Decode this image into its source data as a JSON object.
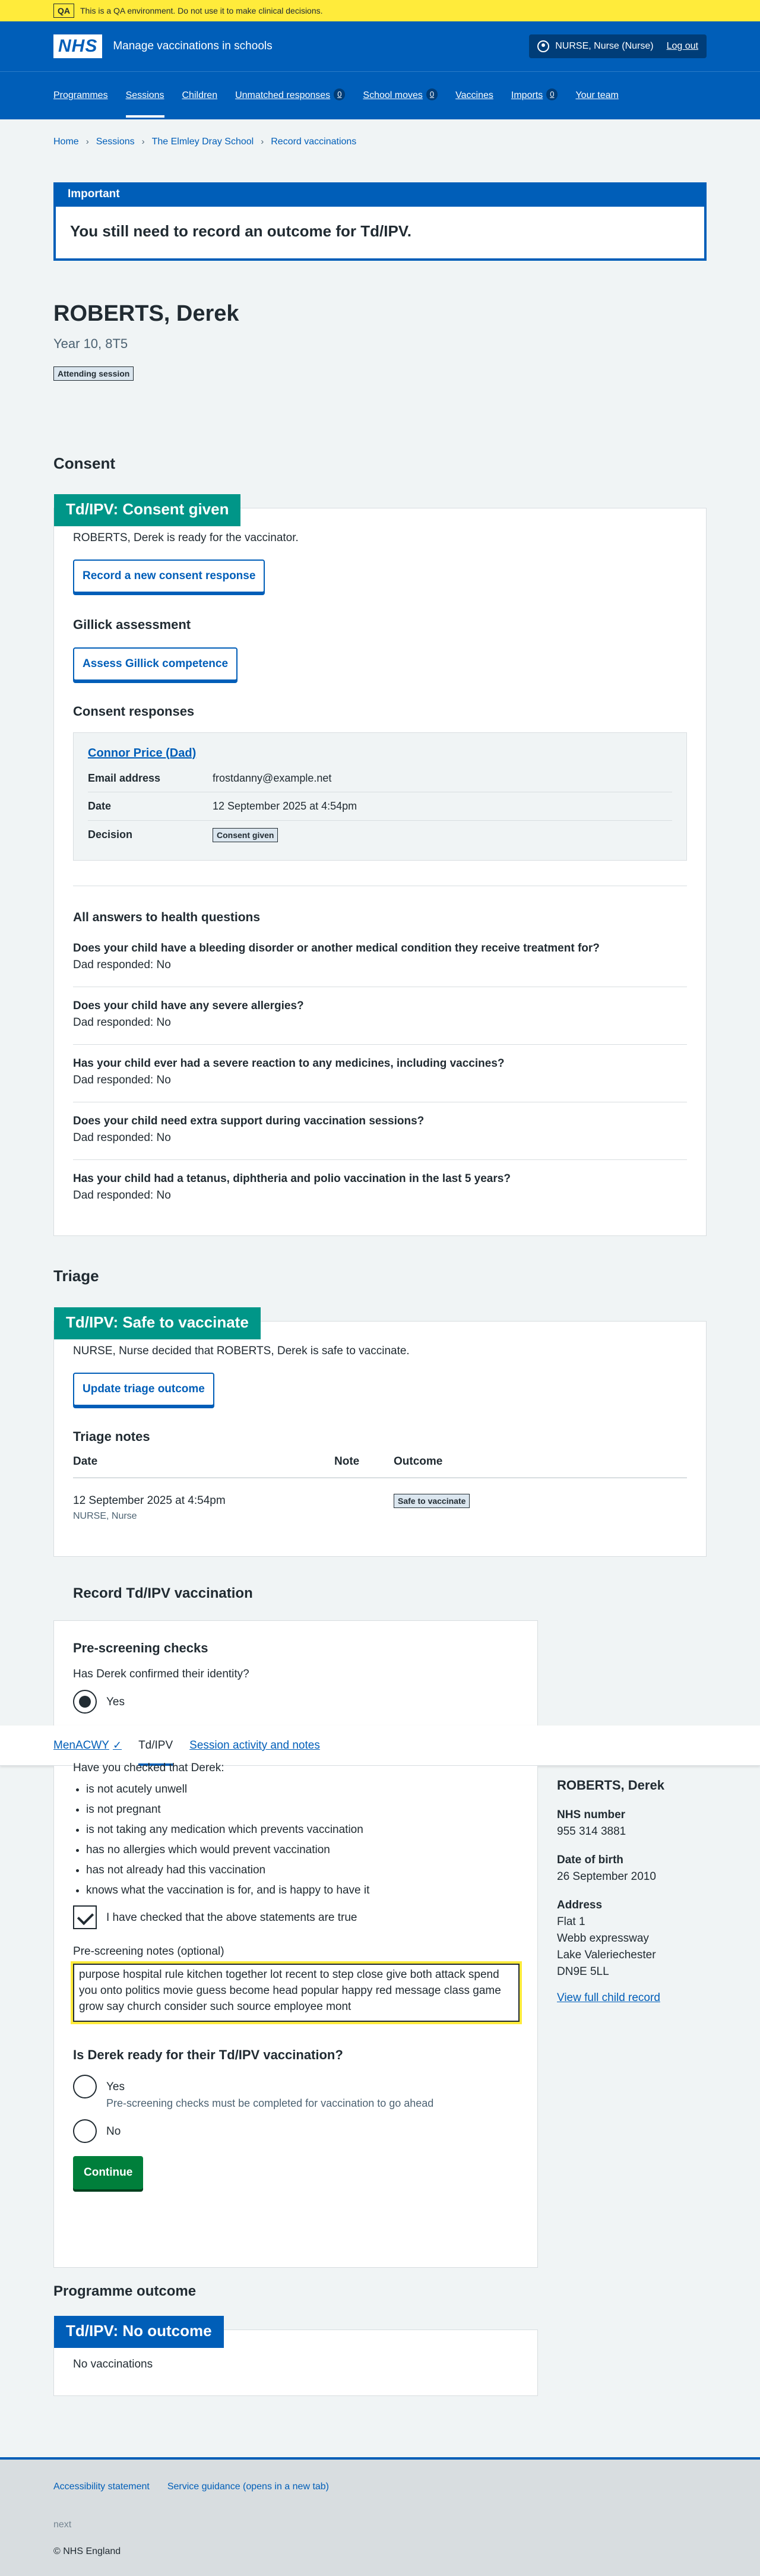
{
  "qa_banner": {
    "tag": "QA",
    "text": "This is a QA environment. Do not use it to make clinical decisions."
  },
  "header": {
    "logo": "NHS",
    "service_name": "Manage vaccinations in schools",
    "user": "NURSE, Nurse (Nurse)",
    "logout": "Log out",
    "nav": [
      {
        "label": "Programmes"
      },
      {
        "label": "Sessions"
      },
      {
        "label": "Children"
      },
      {
        "label": "Unmatched responses",
        "count": "0"
      },
      {
        "label": "School moves",
        "count": "0"
      },
      {
        "label": "Vaccines"
      },
      {
        "label": "Imports",
        "count": "0"
      },
      {
        "label": "Your team"
      }
    ]
  },
  "breadcrumb": [
    "Home",
    "Sessions",
    "The Elmley Dray School",
    "Record vaccinations"
  ],
  "important": {
    "heading": "Important",
    "message": "You still need to record an outcome for Td/IPV."
  },
  "patient": {
    "name": "ROBERTS, Derek",
    "year": "Year 10, 8T5",
    "status_tag": "Attending session"
  },
  "consent": {
    "section_title": "Consent",
    "card_title": "Td/IPV: Consent given",
    "ready_text": "ROBERTS, Derek is ready for the vaccinator.",
    "record_button": "Record a new consent response",
    "gillick_title": "Gillick assessment",
    "gillick_button": "Assess Gillick competence",
    "responses_title": "Consent responses",
    "response": {
      "name": "Connor Price (Dad)",
      "email_label": "Email address",
      "email": "frostdanny@example.net",
      "date_label": "Date",
      "date": "12 September 2025 at 4:54pm",
      "decision_label": "Decision",
      "decision": "Consent given"
    },
    "health_title": "All answers to health questions",
    "questions": [
      {
        "q": "Does your child have a bleeding disorder or another medical condition they receive treatment for?",
        "a": "Dad responded: No"
      },
      {
        "q": "Does your child have any severe allergies?",
        "a": "Dad responded: No"
      },
      {
        "q": "Has your child ever had a severe reaction to any medicines, including vaccines?",
        "a": "Dad responded: No"
      },
      {
        "q": "Does your child need extra support during vaccination sessions?",
        "a": "Dad responded: No"
      },
      {
        "q": "Has your child had a tetanus, diphtheria and polio vaccination in the last 5 years?",
        "a": "Dad responded: No"
      }
    ]
  },
  "triage": {
    "section_title": "Triage",
    "card_title": "Td/IPV: Safe to vaccinate",
    "decision_text": "NURSE, Nurse decided that ROBERTS, Derek is safe to vaccinate.",
    "update_button": "Update triage outcome",
    "notes_title": "Triage notes",
    "columns": [
      "Date",
      "Note",
      "Outcome"
    ],
    "row": {
      "date": "12 September 2025 at 4:54pm",
      "by": "NURSE, Nurse",
      "note": "",
      "outcome": "Safe to vaccinate"
    }
  },
  "record": {
    "title": "Record Td/IPV vaccination",
    "prescreen_title": "Pre-screening checks",
    "identity_q": "Has Derek confirmed their identity?",
    "yes": "Yes",
    "checked_q": "Have you checked that Derek:",
    "checks": [
      "is not acutely unwell",
      "is not pregnant",
      "is not taking any medication which prevents vaccination",
      "has no allergies which would prevent vaccination",
      "has not already had this vaccination",
      "knows what the vaccination is for, and is happy to have it"
    ],
    "confirm_label": "I have checked that the above statements are true",
    "notes_label": "Pre-screening notes (optional)",
    "notes_value": "purpose hospital rule kitchen together lot recent to step close give both attack spend you onto politics movie guess become head popular happy red message class game grow say church consider such source employee mont",
    "ready_q": "Is Derek ready for their Td/IPV vaccination?",
    "ready_yes": "Yes",
    "ready_hint": "Pre-screening checks must be completed for vaccination to go ahead",
    "ready_no": "No",
    "continue": "Continue"
  },
  "tabs": {
    "items": [
      "MenACWY",
      "Td/IPV",
      "Session activity and notes"
    ],
    "tick": "✓"
  },
  "sidebar": {
    "name": "ROBERTS, Derek",
    "nhs_label": "NHS number",
    "nhs": "955 314 3881",
    "dob_label": "Date of birth",
    "dob": "26 September 2010",
    "address_label": "Address",
    "address": [
      "Flat 1",
      "Webb expressway",
      "Lake Valeriechester",
      "DN9E 5LL"
    ],
    "link": "View full child record"
  },
  "outcome": {
    "section_title": "Programme outcome",
    "card_title": "Td/IPV: No outcome",
    "text": "No vaccinations"
  },
  "footer": {
    "links": [
      "Accessibility statement",
      "Service guidance (opens in a new tab)"
    ],
    "version": "next",
    "copyright": "© NHS England"
  },
  "colors": {
    "nhs_blue": "#005eb8",
    "green": "#009688",
    "button_green": "#007f3b",
    "qa_yellow": "#ffeb3b"
  }
}
